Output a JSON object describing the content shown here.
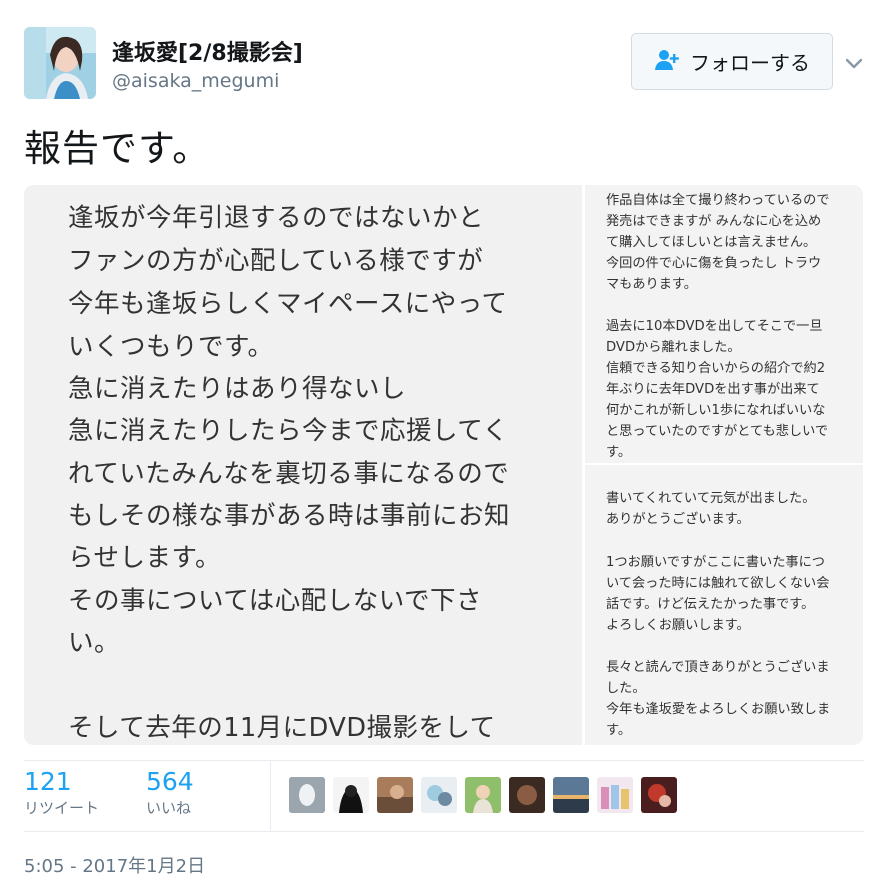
{
  "user": {
    "display_name": "逢坂愛[2/8撮影会]",
    "handle": "@aisaka_megumi"
  },
  "follow_button": {
    "label": "フォローする",
    "icon": "add-user-icon"
  },
  "tweet": {
    "text": "報告です。"
  },
  "note_left": {
    "lines": [
      "逢坂が今年引退するのではないかと",
      "ファンの方が心配している様ですが",
      "今年も逢坂らしくマイペースにやって",
      "いくつもりです。",
      "急に消えたりはあり得ないし",
      "急に消えたりしたら今まで応援してく",
      "れていたみんなを裏切る事になるので",
      "もしその様な事がある時は事前にお知",
      "らせします。",
      "その事については心配しないで下さ",
      "い。",
      "",
      "そして去年の11月にDVD撮影をして"
    ]
  },
  "note_right_top": {
    "lines": [
      "作品自体は全て撮り終わっているので",
      "発売はできますが みんなに心を込め",
      "て購入してほしいとは言えません。",
      "今回の件で心に傷を負ったし トラウ",
      "マもあります。",
      "",
      "過去に10本DVDを出してそこで一旦",
      "DVDから離れました。",
      "信頼できる知り合いからの紹介で約2",
      "年ぶりに去年DVDを出す事が出来て",
      "何かこれが新しい1歩になればいいな",
      "と思っていたのですがとても悲しいで",
      "す。"
    ]
  },
  "note_right_bottom": {
    "lines": [
      "書いてくれていて元気が出ました。",
      "ありがとうございます。",
      "",
      "1つお願いですがここに書いた事につ",
      "いて会った時には触れて欲しくない会",
      "話です。けど伝えたかった事です。",
      "よろしくお願いします。",
      "",
      "長々と読んで頂きありがとうございま",
      "した。",
      "今年も逢坂愛をよろしくお願い致しま",
      "す。"
    ]
  },
  "stats": {
    "retweets": {
      "value": "121",
      "label": "リツイート"
    },
    "likes": {
      "value": "564",
      "label": "いいね"
    }
  },
  "likers_count_shown": 9,
  "timestamp": "5:05 - 2017年1月2日",
  "colors": {
    "accent": "#1da1f2",
    "muted": "#657786",
    "text": "#14171a",
    "border": "#e6ecf0"
  }
}
